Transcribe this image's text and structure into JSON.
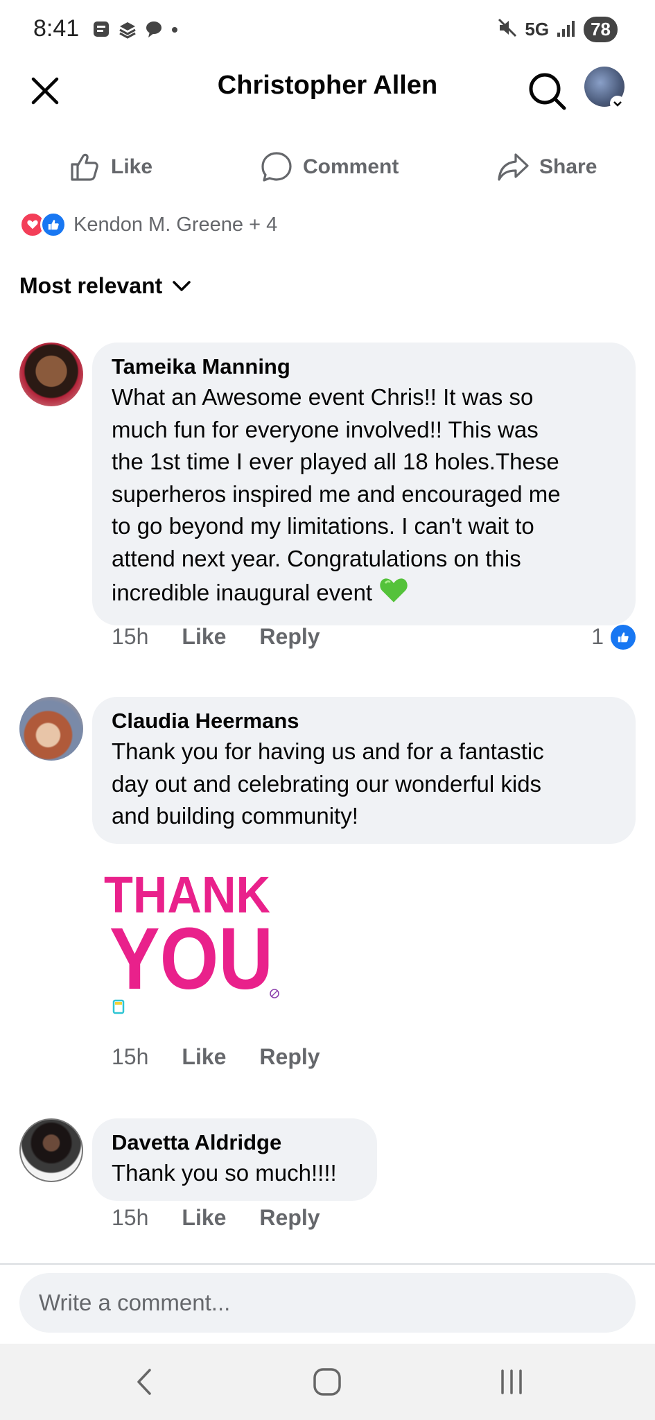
{
  "status_bar": {
    "time": "8:41",
    "network": "5G",
    "battery": "78"
  },
  "header": {
    "title": "Christopher Allen"
  },
  "actions": {
    "like": "Like",
    "comment": "Comment",
    "share": "Share"
  },
  "reactions": {
    "summary": "Kendon M. Greene + 4"
  },
  "sort": {
    "label": "Most relevant"
  },
  "comments": [
    {
      "author": "Tameika Manning",
      "lines": [
        "What an Awesome event Chris!! It was so",
        "much fun for everyone involved!! This was",
        "the 1st time I ever played all 18 holes.These",
        "superheros inspired me and encouraged me",
        "to go beyond my limitations. I can't wait to",
        "attend next year. Congratulations on this",
        "incredible inaugural event"
      ],
      "time": "15h",
      "like": "Like",
      "reply": "Reply",
      "like_count": "1"
    },
    {
      "author": "Claudia Heermans",
      "lines": [
        "Thank you for having us and for a fantastic",
        "day out and celebrating our wonderful kids",
        "and building community!"
      ],
      "time": "15h",
      "like": "Like",
      "reply": "Reply"
    },
    {
      "author": "Davetta Aldridge",
      "lines": [
        "Thank you so much!!!!"
      ],
      "time": "15h",
      "like": "Like",
      "reply": "Reply"
    }
  ],
  "sticker": {
    "line1": "THANK",
    "line2": "YOU",
    "color": "#e9218b"
  },
  "composer": {
    "placeholder": "Write a comment..."
  },
  "colors": {
    "accent": "#1877f2",
    "heart": "#f33e58",
    "secondary_text": "#65676b",
    "bubble": "#f0f2f5"
  }
}
